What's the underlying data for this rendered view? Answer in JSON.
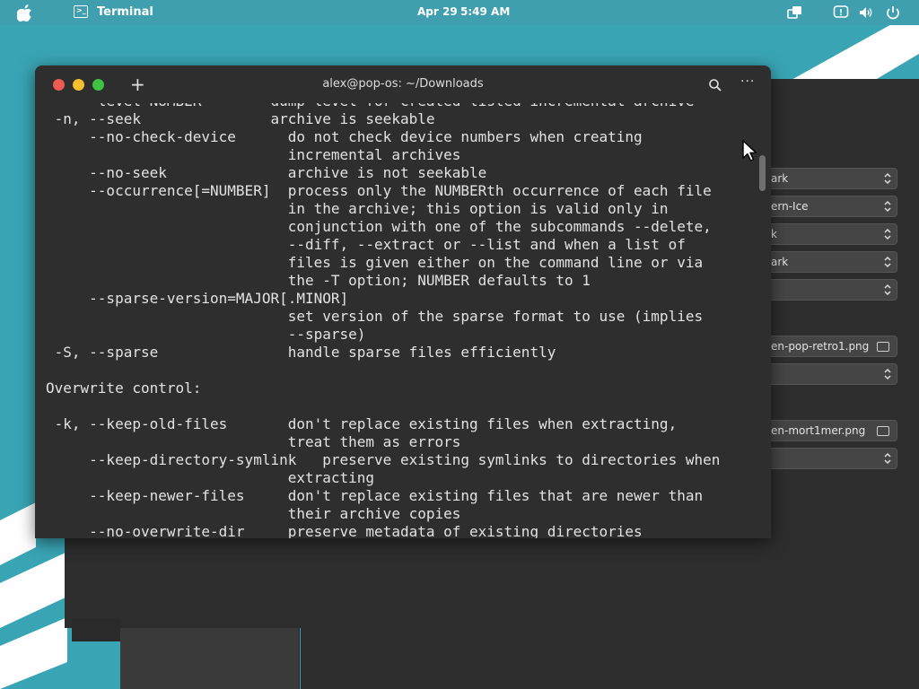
{
  "top_panel": {
    "app_name": "Terminal",
    "date": "Apr 29",
    "time": "5:49 AM",
    "icons": [
      "apple-icon",
      "terminal-app-icon",
      "workspaces-icon",
      "notification-icon",
      "volume-icon",
      "power-icon"
    ]
  },
  "terminal": {
    "title": "alex@pop-os: ~/Downloads",
    "lines": [
      "    --level=NUMBER        dump level for created listed-incremental archive",
      " -n, --seek               archive is seekable",
      "     --no-check-device      do not check device numbers when creating",
      "                            incremental archives",
      "     --no-seek              archive is not seekable",
      "     --occurrence[=NUMBER]  process only the NUMBERth occurrence of each file",
      "                            in the archive; this option is valid only in",
      "                            conjunction with one of the subcommands --delete,",
      "                            --diff, --extract or --list and when a list of",
      "                            files is given either on the command line or via",
      "                            the -T option; NUMBER defaults to 1",
      "     --sparse-version=MAJOR[.MINOR]",
      "                            set version of the sparse format to use (implies",
      "                            --sparse)",
      " -S, --sparse               handle sparse files efficiently",
      "",
      "Overwrite control:",
      "",
      " -k, --keep-old-files       don't replace existing files when extracting,",
      "                            treat them as errors",
      "     --keep-directory-symlink   preserve existing symlinks to directories when",
      "                            extracting",
      "     --keep-newer-files     don't replace existing files that are newer than",
      "                            their archive copies",
      "     --no-overwrite-dir     preserve metadata of existing directories"
    ]
  },
  "settings_window": {
    "combos": [
      "ark",
      "ern-Ice",
      "k",
      "ark",
      "",
      ""
    ],
    "file_pickers": [
      "en-pop-retro1.png",
      "en-mort1mer.png"
    ],
    "extra_combos": [
      "",
      ""
    ]
  },
  "colors": {
    "wallpaper": "#39a4b4",
    "panel": "#3f9faf",
    "terminal_bg": "#2e2e2e",
    "close": "#ed5b53",
    "minimize": "#f5be2f",
    "maximize": "#3ec344"
  }
}
